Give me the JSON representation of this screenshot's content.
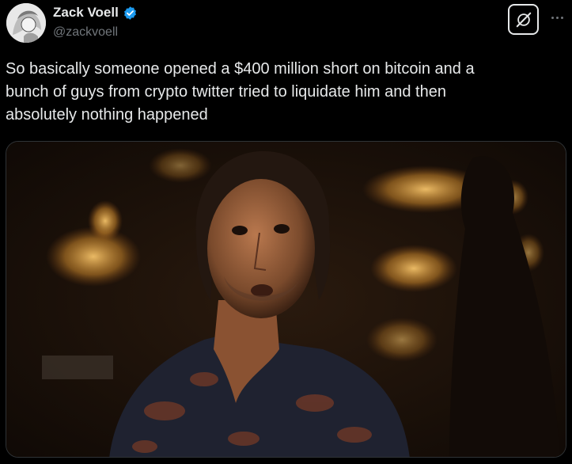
{
  "author": {
    "display_name": "Zack Voell",
    "handle": "@zackvoell",
    "verified": true,
    "avatar_icon": "avatar-illustration"
  },
  "actions": {
    "grok_icon": "grok-icon",
    "more_icon": "more-icon"
  },
  "tweet": {
    "text": "So basically someone opened a $400 million short on bitcoin and a\nbunch of guys from crypto twitter tried to liquidate him and then\nabsolutely nothing happened"
  },
  "media": {
    "type": "image",
    "subject": "man-surprised-still"
  },
  "colors": {
    "background": "#000000",
    "text": "#e7e9ea",
    "secondary": "#71767b",
    "verified": "#1d9bf0"
  }
}
